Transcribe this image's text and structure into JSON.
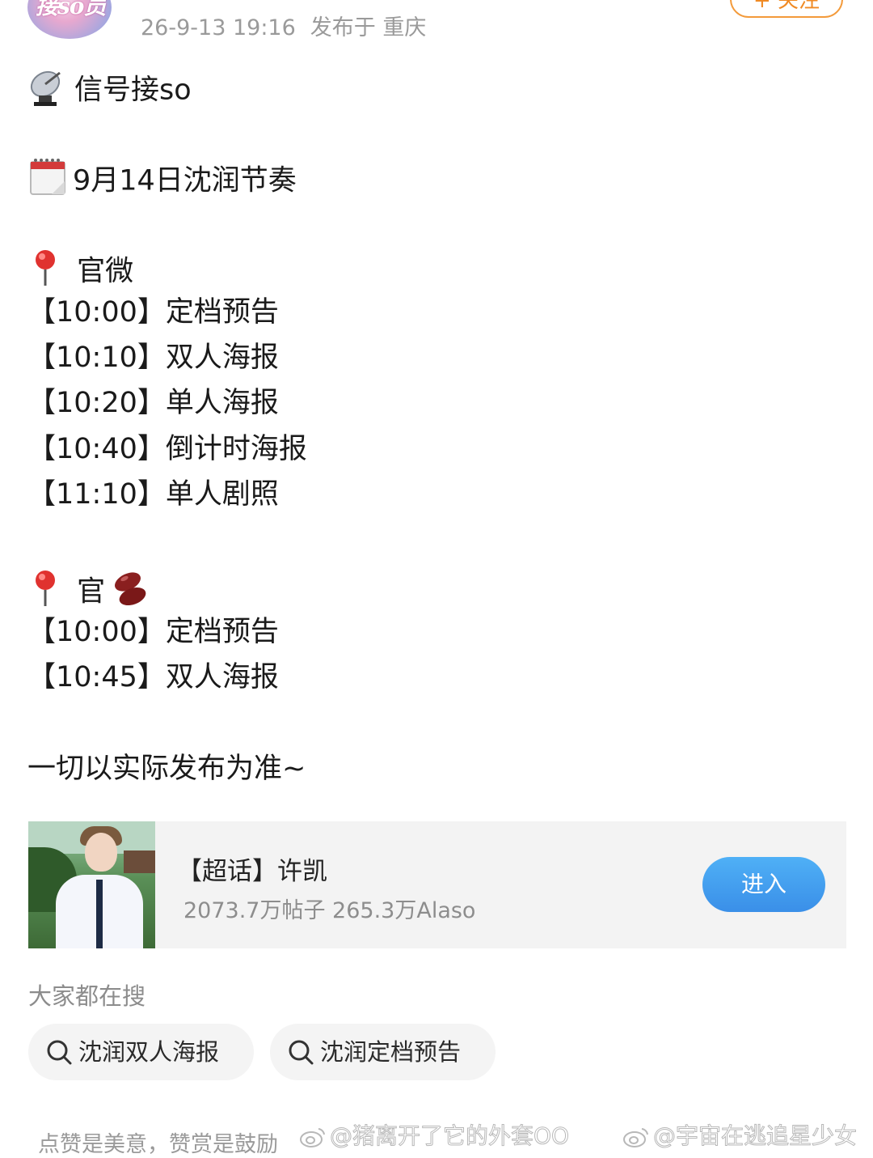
{
  "header": {
    "avatar_text": "接so员",
    "timestamp": "26-9-13 19:16",
    "location": "发布于 重庆",
    "follow_label": "+ 关注"
  },
  "post": {
    "lines": [
      {
        "emoji": "satellite-dish-icon",
        "text": "信号接so"
      },
      {
        "emoji": "calendar-icon",
        "text": "9月14日沈润节奏"
      },
      {
        "emoji": "pin-icon",
        "text": " 官微"
      },
      {
        "emoji": "",
        "text": "【10:00】定档预告"
      },
      {
        "emoji": "",
        "text": "【10:10】双人海报"
      },
      {
        "emoji": "",
        "text": "【10:20】单人海报"
      },
      {
        "emoji": "",
        "text": "【10:40】倒计时海报"
      },
      {
        "emoji": "",
        "text": "【11:10】单人剧照"
      },
      {
        "emoji": "pin-icon",
        "text": " 官"
      },
      {
        "emoji": "",
        "text": "【10:00】定档预告"
      },
      {
        "emoji": "",
        "text": "【10:45】双人海报"
      },
      {
        "emoji": "",
        "text": "一切以实际发布为准~"
      }
    ]
  },
  "topic_card": {
    "title": "【超话】许凯",
    "stats": "2073.7万帖子 265.3万Alaso",
    "enter_label": "进入"
  },
  "search": {
    "label": "大家都在搜",
    "chips": [
      "沈润双人海报",
      "沈润定档预告"
    ]
  },
  "footer": {
    "text": "点赞是美意，赞赏是鼓励",
    "watermark1": "@猪离开了它的外套OO",
    "watermark2": "@宇宙在逃追星少女"
  },
  "colors": {
    "accent_blue": "#3a8fe8",
    "follow_orange": "#f08a24",
    "muted_text": "#9a9a9a"
  }
}
